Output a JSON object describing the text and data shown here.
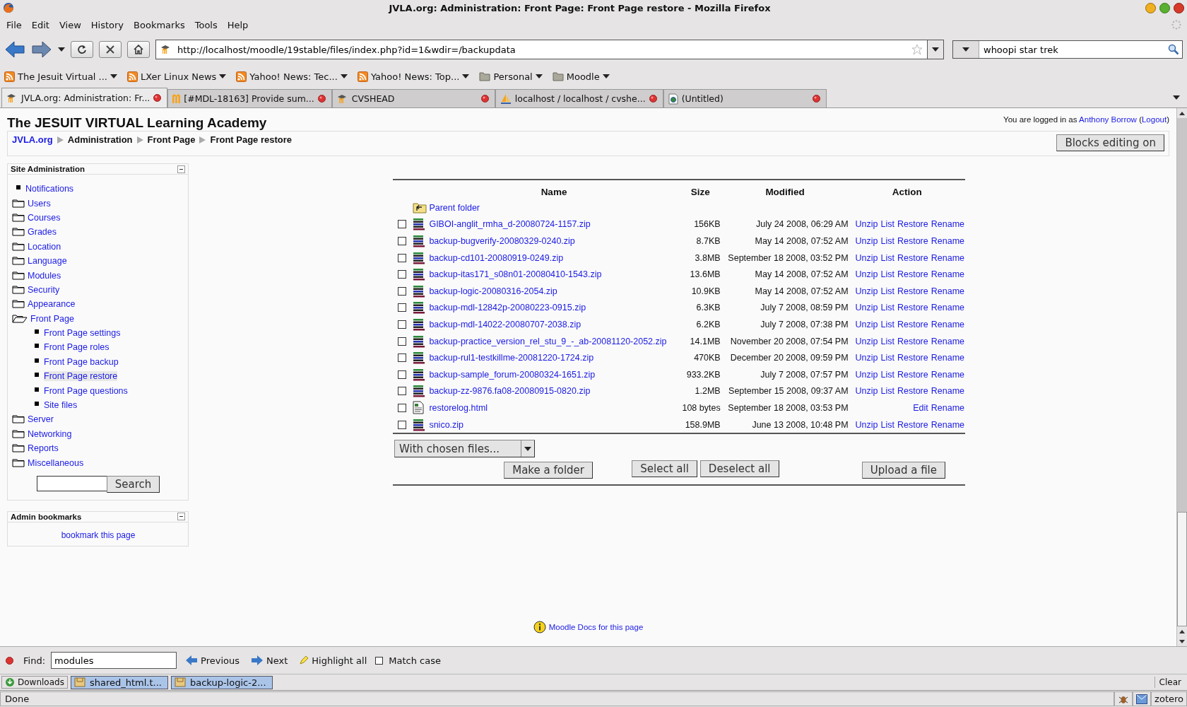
{
  "window": {
    "title": "JVLA.org: Administration: Front Page: Front Page restore - Mozilla Firefox"
  },
  "menu": [
    "File",
    "Edit",
    "View",
    "History",
    "Bookmarks",
    "Tools",
    "Help"
  ],
  "navigation": {
    "url": "http://localhost/moodle/19stable/files/index.php?id=1&wdir=/backupdata",
    "search_value": "whoopi star trek"
  },
  "bookmarks": [
    {
      "label": "The Jesuit Virtual ...",
      "kind": "feed"
    },
    {
      "label": "LXer Linux News",
      "kind": "feed"
    },
    {
      "label": "Yahoo! News: Tec...",
      "kind": "feed"
    },
    {
      "label": "Yahoo! News: Top...",
      "kind": "feed"
    },
    {
      "label": "Personal",
      "kind": "folder"
    },
    {
      "label": "Moodle",
      "kind": "folder"
    }
  ],
  "tabs": [
    {
      "label": "JVLA.org: Administration: Fr...",
      "kind": "moodle",
      "selected": true
    },
    {
      "label": "[#MDL-18163] Provide sum...",
      "kind": "tracker",
      "selected": false
    },
    {
      "label": "CVSHEAD",
      "kind": "moodle",
      "selected": false
    },
    {
      "label": "localhost / localhost / cvshe...",
      "kind": "pma",
      "selected": false
    },
    {
      "label": "(Untitled)",
      "kind": "page",
      "selected": false
    }
  ],
  "page": {
    "site_title": "The JESUIT VIRTUAL Learning Academy",
    "login": {
      "prefix": "You are logged in as",
      "user": "Anthony Borrow",
      "open": "(",
      "logout": "Logout",
      "close": ")"
    },
    "breadcrumb": [
      "JVLA.org",
      "Administration",
      "Front Page",
      "Front Page restore"
    ],
    "blocks_button": "Blocks editing on",
    "site_administration": {
      "title": "Site Administration",
      "items": [
        {
          "label": "Notifications",
          "kind": "leaf",
          "selected": false
        },
        {
          "label": "Users",
          "kind": "folder",
          "expanded": false,
          "selected": false
        },
        {
          "label": "Courses",
          "kind": "folder",
          "expanded": false,
          "selected": false
        },
        {
          "label": "Grades",
          "kind": "folder",
          "expanded": false,
          "selected": false
        },
        {
          "label": "Location",
          "kind": "folder",
          "expanded": false,
          "selected": false
        },
        {
          "label": "Language",
          "kind": "folder",
          "expanded": false,
          "selected": false
        },
        {
          "label": "Modules",
          "kind": "folder",
          "expanded": false,
          "selected": false
        },
        {
          "label": "Security",
          "kind": "folder",
          "expanded": false,
          "selected": false
        },
        {
          "label": "Appearance",
          "kind": "folder",
          "expanded": false,
          "selected": false
        },
        {
          "label": "Front Page",
          "kind": "folder",
          "expanded": true,
          "selected": false,
          "children": [
            {
              "label": "Front Page settings",
              "kind": "leaf",
              "selected": false
            },
            {
              "label": "Front Page roles",
              "kind": "leaf",
              "selected": false
            },
            {
              "label": "Front Page backup",
              "kind": "leaf",
              "selected": false
            },
            {
              "label": "Front Page restore",
              "kind": "leaf",
              "selected": true
            },
            {
              "label": "Front Page questions",
              "kind": "leaf",
              "selected": false
            },
            {
              "label": "Site files",
              "kind": "leaf",
              "selected": false
            }
          ]
        },
        {
          "label": "Server",
          "kind": "folder",
          "expanded": false,
          "selected": false
        },
        {
          "label": "Networking",
          "kind": "folder",
          "expanded": false,
          "selected": false
        },
        {
          "label": "Reports",
          "kind": "folder",
          "expanded": false,
          "selected": false
        },
        {
          "label": "Miscellaneous",
          "kind": "folder",
          "expanded": false,
          "selected": false
        }
      ],
      "search_button": "Search"
    },
    "admin_bookmarks": {
      "title": "Admin bookmarks",
      "link": "bookmark this page"
    },
    "files": {
      "columns": [
        "Name",
        "Size",
        "Modified",
        "Action"
      ],
      "parent_folder": "Parent folder",
      "rows": [
        {
          "name": "GIBOI-anglit_rmha_d-20080724-1157.zip",
          "kind": "zip",
          "size": "156KB",
          "modified": "July 24 2008, 06:29 AM",
          "actions": [
            "Unzip",
            "List",
            "Restore",
            "Rename"
          ],
          "checked": false
        },
        {
          "name": "backup-bugverify-20080329-0240.zip",
          "kind": "zip",
          "size": "8.7KB",
          "modified": "May 14 2008, 07:52 AM",
          "actions": [
            "Unzip",
            "List",
            "Restore",
            "Rename"
          ],
          "checked": false
        },
        {
          "name": "backup-cd101-20080919-0249.zip",
          "kind": "zip",
          "size": "3.8MB",
          "modified": "September 18 2008, 03:52 PM",
          "actions": [
            "Unzip",
            "List",
            "Restore",
            "Rename"
          ],
          "checked": false
        },
        {
          "name": "backup-itas171_s08n01-20080410-1543.zip",
          "kind": "zip",
          "size": "13.6MB",
          "modified": "May 14 2008, 07:52 AM",
          "actions": [
            "Unzip",
            "List",
            "Restore",
            "Rename"
          ],
          "checked": false
        },
        {
          "name": "backup-logic-20080316-2054.zip",
          "kind": "zip",
          "size": "10.9KB",
          "modified": "May 14 2008, 07:52 AM",
          "actions": [
            "Unzip",
            "List",
            "Restore",
            "Rename"
          ],
          "checked": false
        },
        {
          "name": "backup-mdl-12842p-20080223-0915.zip",
          "kind": "zip",
          "size": "6.3KB",
          "modified": "July 7 2008, 08:59 PM",
          "actions": [
            "Unzip",
            "List",
            "Restore",
            "Rename"
          ],
          "checked": false
        },
        {
          "name": "backup-mdl-14022-20080707-2038.zip",
          "kind": "zip",
          "size": "6.2KB",
          "modified": "July 7 2008, 07:38 PM",
          "actions": [
            "Unzip",
            "List",
            "Restore",
            "Rename"
          ],
          "checked": false
        },
        {
          "name": "backup-practice_version_rel_stu_9_-_ab-20081120-2052.zip",
          "kind": "zip",
          "size": "14.1MB",
          "modified": "November 20 2008, 07:54 PM",
          "actions": [
            "Unzip",
            "List",
            "Restore",
            "Rename"
          ],
          "checked": false
        },
        {
          "name": "backup-rul1-testkillme-20081220-1724.zip",
          "kind": "zip",
          "size": "470KB",
          "modified": "December 20 2008, 09:59 PM",
          "actions": [
            "Unzip",
            "List",
            "Restore",
            "Rename"
          ],
          "checked": false
        },
        {
          "name": "backup-sample_forum-20080324-1651.zip",
          "kind": "zip",
          "size": "933.2KB",
          "modified": "July 7 2008, 07:57 PM",
          "actions": [
            "Unzip",
            "List",
            "Restore",
            "Rename"
          ],
          "checked": false
        },
        {
          "name": "backup-zz-9876.fa08-20080915-0820.zip",
          "kind": "zip",
          "size": "1.2MB",
          "modified": "September 15 2008, 09:37 AM",
          "actions": [
            "Unzip",
            "List",
            "Restore",
            "Rename"
          ],
          "checked": false
        },
        {
          "name": "restorelog.html",
          "kind": "html",
          "size": "108 bytes",
          "modified": "September 18 2008, 03:53 PM",
          "actions": [
            "Edit",
            "Rename"
          ],
          "checked": false
        },
        {
          "name": "snico.zip",
          "kind": "zip",
          "size": "158.9MB",
          "modified": "June 13 2008, 10:48 PM",
          "actions": [
            "Unzip",
            "List",
            "Restore",
            "Rename"
          ],
          "checked": false
        }
      ],
      "chosen_select": "With chosen files...",
      "make_folder": "Make a folder",
      "select_all": "Select all",
      "deselect_all": "Deselect all",
      "upload": "Upload a file"
    },
    "docs_link": "Moodle Docs for this page"
  },
  "find_bar": {
    "label": "Find:",
    "value": "modules",
    "previous": "Previous",
    "next": "Next",
    "highlight": "Highlight all",
    "match_case": {
      "label": "Match case",
      "checked": false
    }
  },
  "downloads": {
    "label": "Downloads",
    "items": [
      "shared_html.t...",
      "backup-logic-2..."
    ],
    "clear": "Clear"
  },
  "status_bar": {
    "text": "Done",
    "zotero": "zotero"
  }
}
